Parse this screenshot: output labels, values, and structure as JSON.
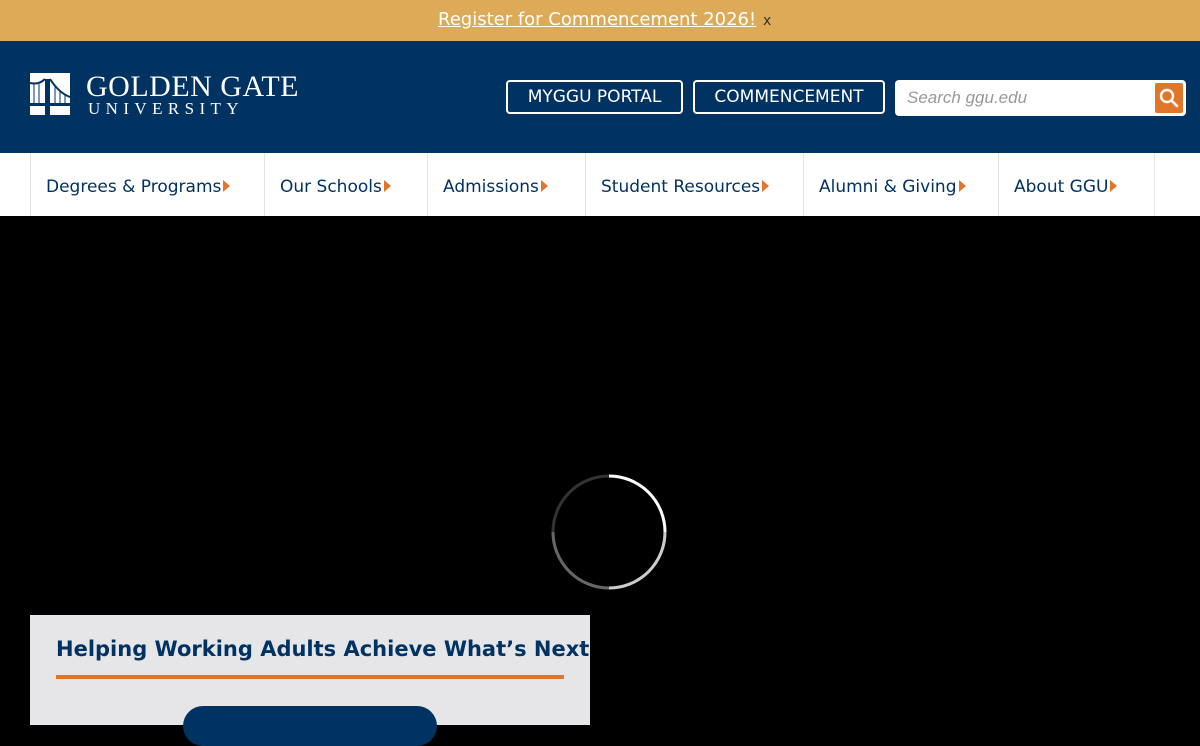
{
  "announcement": {
    "link_text": "Register for Commencement 2026!",
    "close_label": "x"
  },
  "header": {
    "logo": {
      "line1": "GOLDEN GATE",
      "line2": "UNIVERSITY"
    },
    "buttons": {
      "portal_label": "MYGGU PORTAL",
      "commencement_label": "COMMENCEMENT"
    },
    "search": {
      "placeholder": "Search ggu.edu",
      "icon": "search-icon"
    }
  },
  "nav": {
    "items": [
      {
        "label": "Degrees & Programs",
        "icon": "caret-right-icon"
      },
      {
        "label": "Our Schools",
        "icon": "caret-right-icon"
      },
      {
        "label": "Admissions",
        "icon": "caret-right-icon"
      },
      {
        "label": "Student Resources",
        "icon": "caret-right-icon"
      },
      {
        "label": "Alumni & Giving",
        "icon": "caret-right-icon"
      },
      {
        "label": "About GGU",
        "icon": "caret-right-icon"
      }
    ]
  },
  "hero": {
    "loading_icon": "spinner-icon",
    "card": {
      "title": "Helping Working Adults Achieve What’s Next"
    }
  },
  "colors": {
    "navy": "#003262",
    "gold": "#ddaa57",
    "orange": "#e1762a",
    "card_bg": "#e6e6e8"
  }
}
